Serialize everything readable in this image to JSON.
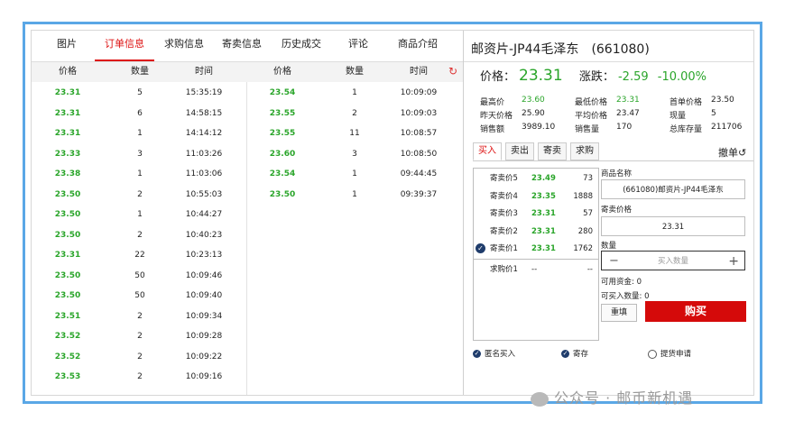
{
  "tabs": [
    "图片",
    "订单信息",
    "求购信息",
    "寄卖信息",
    "历史成交",
    "评论",
    "商品介绍"
  ],
  "active_tab": 1,
  "table_headers": {
    "price": "价格",
    "qty": "数量",
    "time": "时间"
  },
  "orders_left": [
    {
      "price": "23.31",
      "qty": "5",
      "time": "15:35:19"
    },
    {
      "price": "23.31",
      "qty": "6",
      "time": "14:58:15"
    },
    {
      "price": "23.31",
      "qty": "1",
      "time": "14:14:12"
    },
    {
      "price": "23.33",
      "qty": "3",
      "time": "11:03:26"
    },
    {
      "price": "23.38",
      "qty": "1",
      "time": "11:03:06"
    },
    {
      "price": "23.50",
      "qty": "2",
      "time": "10:55:03"
    },
    {
      "price": "23.50",
      "qty": "1",
      "time": "10:44:27"
    },
    {
      "price": "23.50",
      "qty": "2",
      "time": "10:40:23"
    },
    {
      "price": "23.31",
      "qty": "22",
      "time": "10:23:13"
    },
    {
      "price": "23.50",
      "qty": "50",
      "time": "10:09:46"
    },
    {
      "price": "23.50",
      "qty": "50",
      "time": "10:09:40"
    },
    {
      "price": "23.51",
      "qty": "2",
      "time": "10:09:34"
    },
    {
      "price": "23.52",
      "qty": "2",
      "time": "10:09:28"
    },
    {
      "price": "23.52",
      "qty": "2",
      "time": "10:09:22"
    },
    {
      "price": "23.53",
      "qty": "2",
      "time": "10:09:16"
    }
  ],
  "orders_right": [
    {
      "price": "23.54",
      "qty": "1",
      "time": "10:09:09"
    },
    {
      "price": "23.55",
      "qty": "2",
      "time": "10:09:03"
    },
    {
      "price": "23.55",
      "qty": "11",
      "time": "10:08:57"
    },
    {
      "price": "23.60",
      "qty": "3",
      "time": "10:08:50"
    },
    {
      "price": "23.54",
      "qty": "1",
      "time": "09:44:45"
    },
    {
      "price": "23.50",
      "qty": "1",
      "time": "09:39:37"
    }
  ],
  "product": {
    "title": "邮资片-JP44毛泽东",
    "code": "(661080)",
    "price_label": "价格：",
    "price": "23.31",
    "change_label": "涨跌：",
    "change": "-2.59",
    "change_pct": "-10.00%"
  },
  "stats": [
    {
      "label": "最高价",
      "value": "23.60",
      "green": true
    },
    {
      "label": "最低价格",
      "value": "23.31",
      "green": true
    },
    {
      "label": "首单价格",
      "value": "23.50",
      "green": false
    },
    {
      "label": "昨天价格",
      "value": "25.90",
      "green": false
    },
    {
      "label": "平均价格",
      "value": "23.47",
      "green": false
    },
    {
      "label": "现量",
      "value": "5",
      "green": false
    },
    {
      "label": "销售额",
      "value": "3989.10",
      "green": false
    },
    {
      "label": "销售量",
      "value": "170",
      "green": false
    },
    {
      "label": "总库存量",
      "value": "211706",
      "green": false
    }
  ],
  "trade_tabs": [
    "买入",
    "卖出",
    "寄卖",
    "求购"
  ],
  "cancel_label": "撤单",
  "order_book": [
    {
      "label": "寄卖价5",
      "price": "23.49",
      "qty": "73"
    },
    {
      "label": "寄卖价4",
      "price": "23.35",
      "qty": "1888"
    },
    {
      "label": "寄卖价3",
      "price": "23.31",
      "qty": "57"
    },
    {
      "label": "寄卖价2",
      "price": "23.31",
      "qty": "280"
    },
    {
      "label": "寄卖价1",
      "price": "23.31",
      "qty": "1762"
    }
  ],
  "bid": {
    "label": "求购价1",
    "price": "--",
    "qty": "--"
  },
  "form": {
    "name_label": "商品名称",
    "name_value": "(661080)邮资片-JP44毛泽东",
    "price_label": "寄卖价格",
    "price_value": "23.31",
    "qty_label": "数量",
    "qty_placeholder": "买入数量",
    "funds": "可用资金: 0",
    "buyable": "可买入数量: 0",
    "reset": "重填",
    "buy": "购买"
  },
  "options": [
    {
      "label": "匿名买入",
      "checked": true
    },
    {
      "label": "寄存",
      "checked": true
    },
    {
      "label": "提货申请",
      "checked": false
    }
  ],
  "watermark": "公众号 · 邮币新机遇"
}
